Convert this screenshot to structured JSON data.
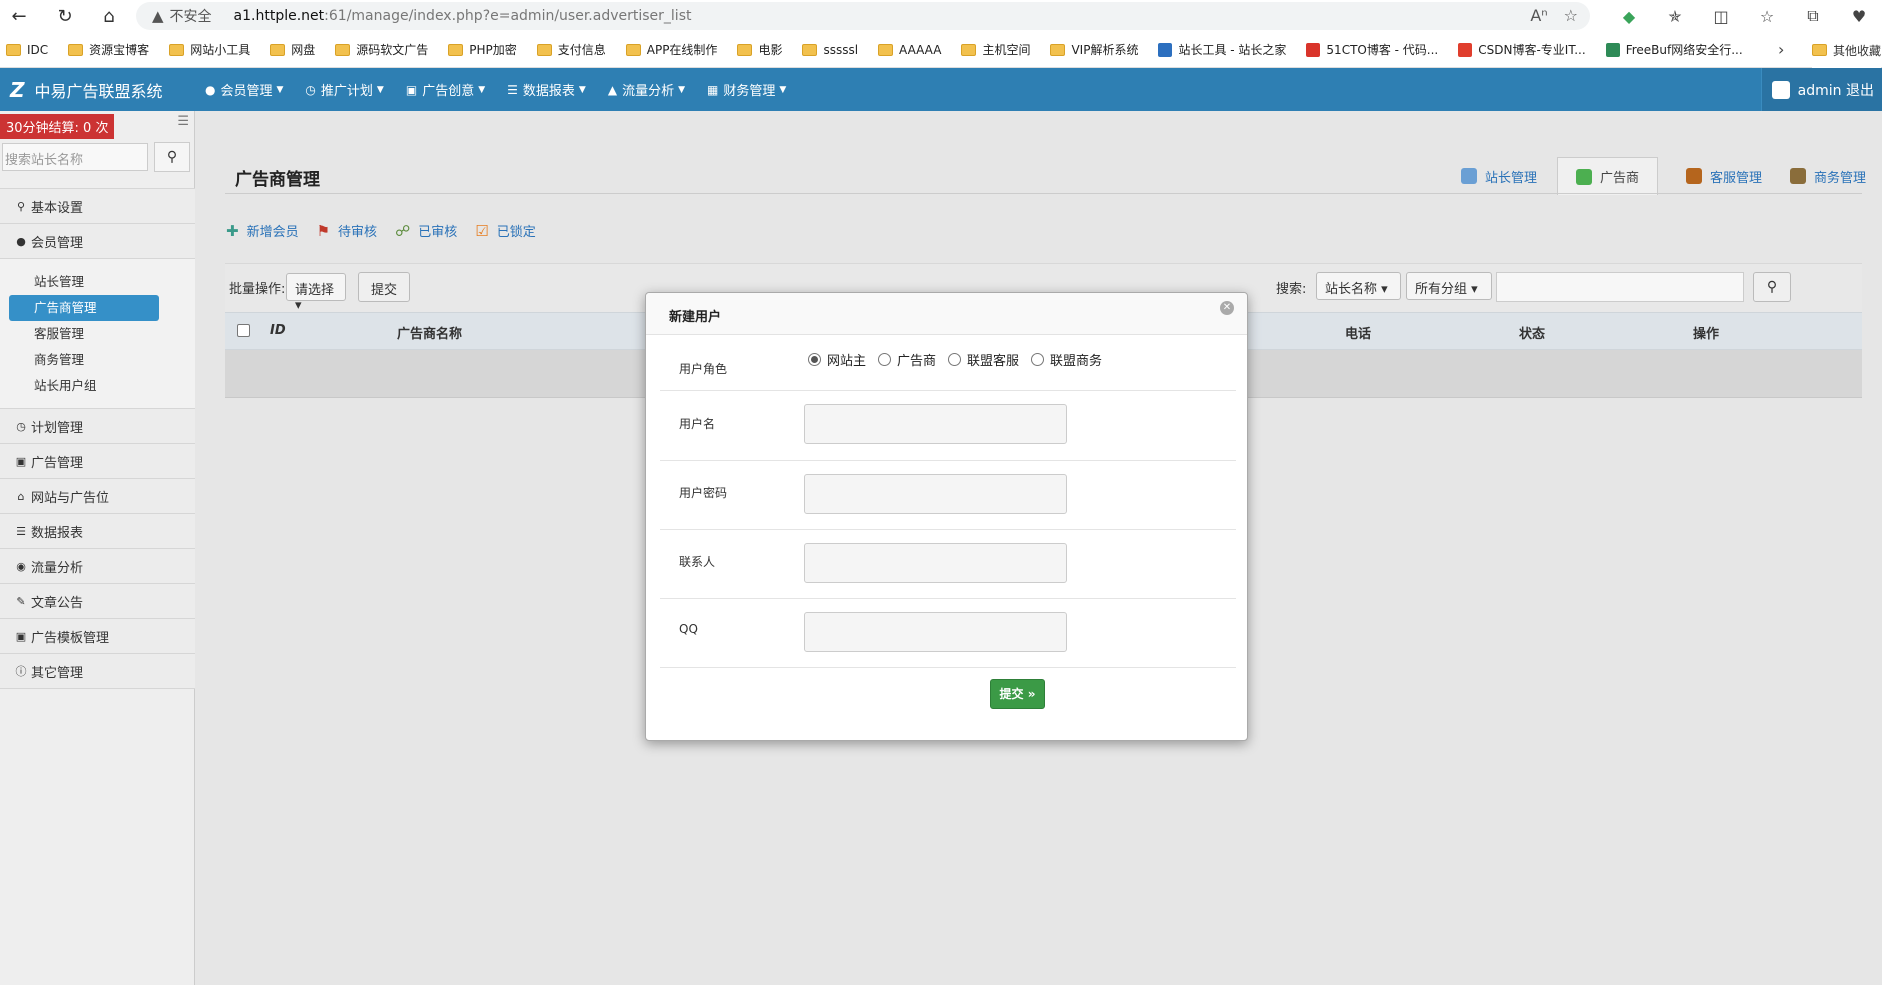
{
  "browser": {
    "url_warning": "不安全",
    "url_host": "a1.httple.net",
    "url_rest": ":61/manage/index.php?e=admin/user.advertiser_list",
    "bookmarks": [
      "IDC",
      "资源宝博客",
      "网站小工具",
      "网盘",
      "源码软文广告",
      "PHP加密",
      "支付信息",
      "APP在线制作",
      "电影",
      "sssssl",
      "AAAAA",
      "主机空间",
      "VIP解析系统",
      "站长工具 - 站长之家",
      "51CTO博客 - 代码...",
      "CSDN博客-专业IT...",
      "FreeBuf网络安全行..."
    ],
    "bookmark_other": "其他收藏"
  },
  "topnav": {
    "brand": "中易广告联盟系统",
    "menu": [
      "会员管理",
      "推广计划",
      "广告创意",
      "数据报表",
      "流量分析",
      "财务管理"
    ],
    "user": "admin 退出"
  },
  "sidebar": {
    "timer": "30分钟结算: 0 次",
    "search_placeholder": "搜索站长名称",
    "sections": [
      {
        "label": "基本设置",
        "icon": "map-marker-icon"
      },
      {
        "label": "会员管理",
        "icon": "user-icon",
        "open": true,
        "items": [
          "站长管理",
          "广告商管理",
          "客服管理",
          "商务管理",
          "站长用户组"
        ],
        "active_index": 1
      },
      {
        "label": "计划管理",
        "icon": "clock-icon"
      },
      {
        "label": "广告管理",
        "icon": "picture-icon"
      },
      {
        "label": "网站与广告位",
        "icon": "home-icon"
      },
      {
        "label": "数据报表",
        "icon": "list-icon"
      },
      {
        "label": "流量分析",
        "icon": "eye-icon"
      },
      {
        "label": "文章公告",
        "icon": "pencil-icon"
      },
      {
        "label": "广告模板管理",
        "icon": "picture-icon"
      },
      {
        "label": "其它管理",
        "icon": "info-icon"
      }
    ]
  },
  "main": {
    "title": "广告商管理",
    "tabs": [
      {
        "label": "站长管理",
        "active": false
      },
      {
        "label": "广告商",
        "active": true
      },
      {
        "label": "客服管理",
        "active": false
      },
      {
        "label": "商务管理",
        "active": false
      }
    ],
    "actions": [
      "新增会员",
      "待审核",
      "已审核",
      "已锁定"
    ],
    "batch_label": "批量操作:",
    "batch_select": "请选择",
    "batch_submit": "提交",
    "search_label": "搜索:",
    "search_field": "站长名称",
    "search_group": "所有分组",
    "columns": [
      "ID",
      "广告商名称",
      "电话",
      "状态",
      "操作"
    ]
  },
  "modal": {
    "title": "新建用户",
    "role_label": "用户角色",
    "roles": [
      "网站主",
      "广告商",
      "联盟客服",
      "联盟商务"
    ],
    "role_selected": 0,
    "fields": [
      "用户名",
      "用户密码",
      "联系人",
      "QQ"
    ],
    "submit": "提交 »"
  }
}
